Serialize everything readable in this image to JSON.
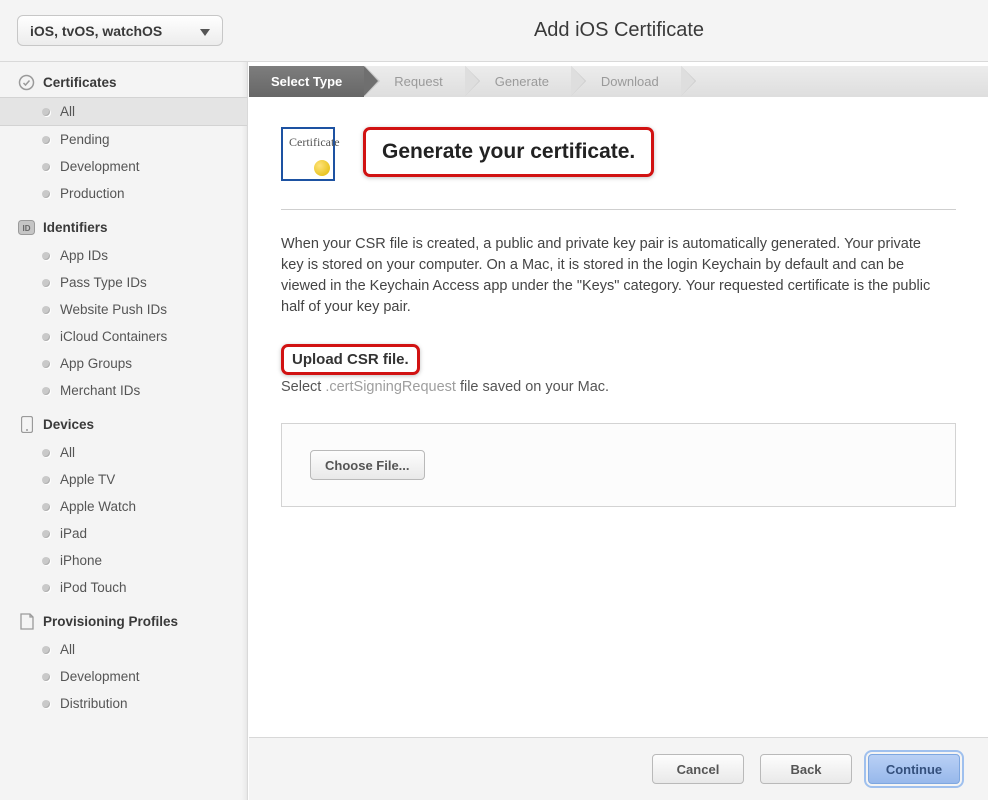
{
  "header": {
    "platform_dropdown": "iOS, tvOS, watchOS",
    "title": "Add iOS Certificate"
  },
  "sidebar": {
    "sections": [
      {
        "title": "Certificates",
        "icon": "certificate-icon",
        "items": [
          {
            "label": "All",
            "selected": true
          },
          {
            "label": "Pending"
          },
          {
            "label": "Development"
          },
          {
            "label": "Production"
          }
        ]
      },
      {
        "title": "Identifiers",
        "icon": "id-icon",
        "items": [
          {
            "label": "App IDs"
          },
          {
            "label": "Pass Type IDs"
          },
          {
            "label": "Website Push IDs"
          },
          {
            "label": "iCloud Containers"
          },
          {
            "label": "App Groups"
          },
          {
            "label": "Merchant IDs"
          }
        ]
      },
      {
        "title": "Devices",
        "icon": "device-icon",
        "items": [
          {
            "label": "All"
          },
          {
            "label": "Apple TV"
          },
          {
            "label": "Apple Watch"
          },
          {
            "label": "iPad"
          },
          {
            "label": "iPhone"
          },
          {
            "label": "iPod Touch"
          }
        ]
      },
      {
        "title": "Provisioning Profiles",
        "icon": "profile-icon",
        "items": [
          {
            "label": "All"
          },
          {
            "label": "Development"
          },
          {
            "label": "Distribution"
          }
        ]
      }
    ]
  },
  "wizard": {
    "steps": [
      {
        "label": "Select Type",
        "active": true
      },
      {
        "label": "Request"
      },
      {
        "label": "Generate"
      },
      {
        "label": "Download"
      }
    ]
  },
  "main": {
    "cert_icon_label": "Certificate",
    "heading": "Generate your certificate.",
    "paragraph": "When your CSR file is created, a public and private key pair is automatically generated. Your private key is stored on your computer. On a Mac, it is stored in the login Keychain by default and can be viewed in the Keychain Access app under the \"Keys\" category. Your requested certificate is the public half of your key pair.",
    "upload_heading": "Upload CSR file.",
    "upload_hint_pre": "Select ",
    "upload_hint_code": ".certSigningRequest",
    "upload_hint_post": " file saved on your Mac.",
    "choose_file_label": "Choose File..."
  },
  "footer": {
    "cancel": "Cancel",
    "back": "Back",
    "continue": "Continue"
  }
}
